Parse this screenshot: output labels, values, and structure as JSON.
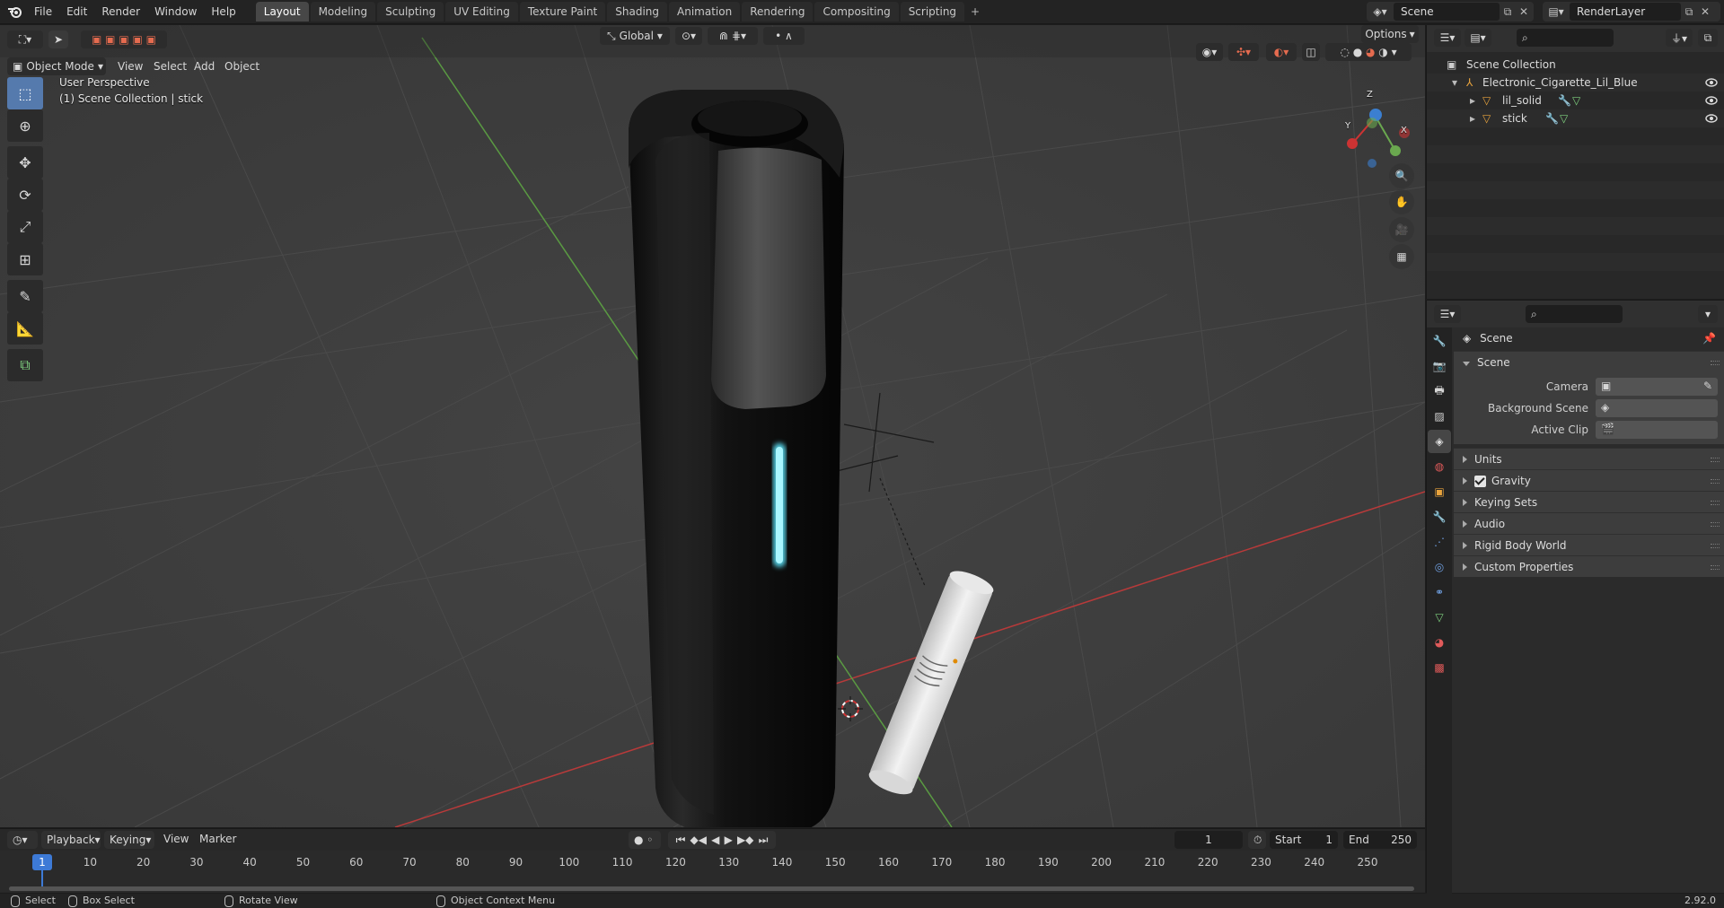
{
  "app": {
    "version": "2.92.0",
    "menu": [
      "File",
      "Edit",
      "Render",
      "Window",
      "Help"
    ],
    "workspaces": [
      "Layout",
      "Modeling",
      "Sculpting",
      "UV Editing",
      "Texture Paint",
      "Shading",
      "Animation",
      "Rendering",
      "Compositing",
      "Scripting"
    ],
    "active_workspace": "Layout",
    "scene_name": "Scene",
    "view_layer": "RenderLayer"
  },
  "viewport": {
    "mode": "Object Mode",
    "menus": [
      "View",
      "Select",
      "Add",
      "Object"
    ],
    "orientation": "Global",
    "options_label": "Options",
    "perspective_label": "User Perspective",
    "collection_label": "(1) Scene Collection | stick",
    "gizmo_axes": [
      "X",
      "Y",
      "Z"
    ]
  },
  "tools": [
    "select-box",
    "cursor",
    "move",
    "rotate",
    "scale",
    "transform",
    "annotate",
    "measure",
    "add-cube"
  ],
  "timeline": {
    "menus": [
      "Playback",
      "Keying",
      "View",
      "Marker"
    ],
    "current_frame": "1",
    "start_label": "Start",
    "start": "1",
    "end_label": "End",
    "end": "250",
    "ruler": [
      "1",
      "10",
      "20",
      "30",
      "40",
      "50",
      "60",
      "70",
      "80",
      "90",
      "100",
      "110",
      "120",
      "130",
      "140",
      "150",
      "160",
      "170",
      "180",
      "190",
      "200",
      "210",
      "220",
      "230",
      "240",
      "250"
    ]
  },
  "status": {
    "select": "Select",
    "box_select": "Box Select",
    "rotate_view": "Rotate View",
    "context_menu": "Object Context Menu"
  },
  "outliner": {
    "root": "Scene Collection",
    "collection": "Electronic_Cigarette_Lil_Blue",
    "objects": [
      "lil_solid",
      "stick"
    ]
  },
  "properties": {
    "context": "Scene",
    "panel_title": "Scene",
    "fields": {
      "camera": "Camera",
      "background_scene": "Background Scene",
      "active_clip": "Active Clip"
    },
    "subpanels": [
      "Units",
      "Gravity",
      "Keying Sets",
      "Audio",
      "Rigid Body World",
      "Custom Properties"
    ]
  },
  "colors": {
    "accent": "#557aad",
    "axis_x": "#d03b3b",
    "axis_y": "#6aa84f",
    "axis_z": "#3b7fd0",
    "led_glow": "#5ee8ff"
  }
}
